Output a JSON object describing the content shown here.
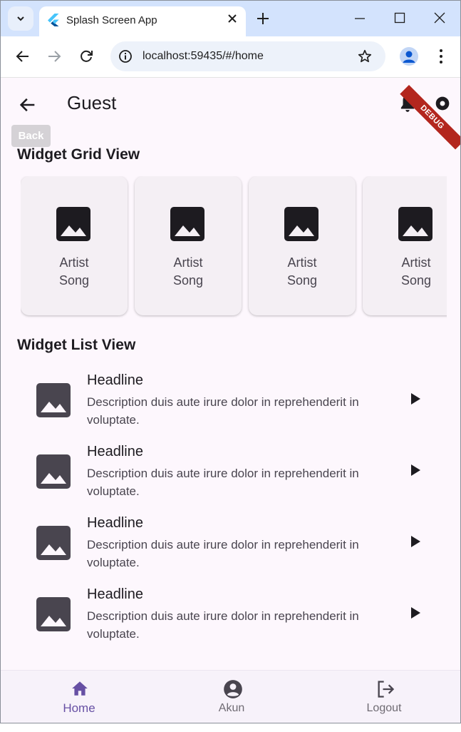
{
  "browser": {
    "tab_title": "Splash Screen App",
    "url": "localhost:59435/#/home",
    "icons": [
      "tab-search-icon",
      "flutter-icon",
      "close-icon",
      "plus-icon",
      "minimize-icon",
      "maximize-icon",
      "close-window-icon",
      "back-arrow-icon",
      "forward-arrow-icon",
      "reload-icon",
      "info-icon",
      "star-icon",
      "profile-icon",
      "menu-dots-icon"
    ]
  },
  "app": {
    "title": "Guest",
    "back_chip_label": "Back",
    "debug_banner": "DEBUG",
    "accent_color": "#6750a4",
    "grid_section_title": "Widget Grid View",
    "grid_items": [
      {
        "line1": "Artist",
        "line2": "Song"
      },
      {
        "line1": "Artist",
        "line2": "Song"
      },
      {
        "line1": "Artist",
        "line2": "Song"
      },
      {
        "line1": "Artist",
        "line2": "Song"
      }
    ],
    "list_section_title": "Widget List View",
    "list_items": [
      {
        "headline": "Headline",
        "description": "Description duis aute irure dolor in reprehenderit in voluptate."
      },
      {
        "headline": "Headline",
        "description": "Description duis aute irure dolor in reprehenderit in voluptate."
      },
      {
        "headline": "Headline",
        "description": "Description duis aute irure dolor in reprehenderit in voluptate."
      },
      {
        "headline": "Headline",
        "description": "Description duis aute irure dolor in reprehenderit in voluptate."
      }
    ],
    "bottom_nav": [
      {
        "label": "Home",
        "icon": "home-icon",
        "active": true
      },
      {
        "label": "Akun",
        "icon": "account-circle-icon",
        "active": false
      },
      {
        "label": "Logout",
        "icon": "logout-icon",
        "active": false
      }
    ]
  }
}
